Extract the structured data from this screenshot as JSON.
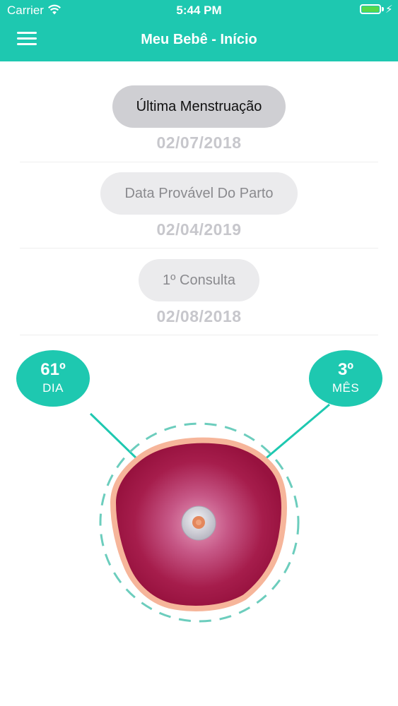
{
  "status_bar": {
    "carrier": "Carrier",
    "time": "5:44 PM",
    "wifi_icon": "wifi-icon",
    "battery_icon": "battery-icon",
    "charging_icon": "bolt-icon"
  },
  "nav": {
    "title": "Meu Bebê - Início",
    "menu_icon": "hamburger-menu-icon"
  },
  "dates": [
    {
      "label": "Última Menstruação",
      "value": "02/07/2018"
    },
    {
      "label": "Data Provável Do Parto",
      "value": "02/04/2019"
    },
    {
      "label": "1º Consulta",
      "value": "02/08/2018"
    }
  ],
  "progress": {
    "day_value": "61º",
    "day_label": "DIA",
    "month_value": "3º",
    "month_label": "MÊS"
  },
  "colors": {
    "accent": "#1ec8b0",
    "embryo_outer": "#a3123f",
    "embryo_border": "#f6b59a",
    "dashed_ring": "#6ccdbd"
  }
}
